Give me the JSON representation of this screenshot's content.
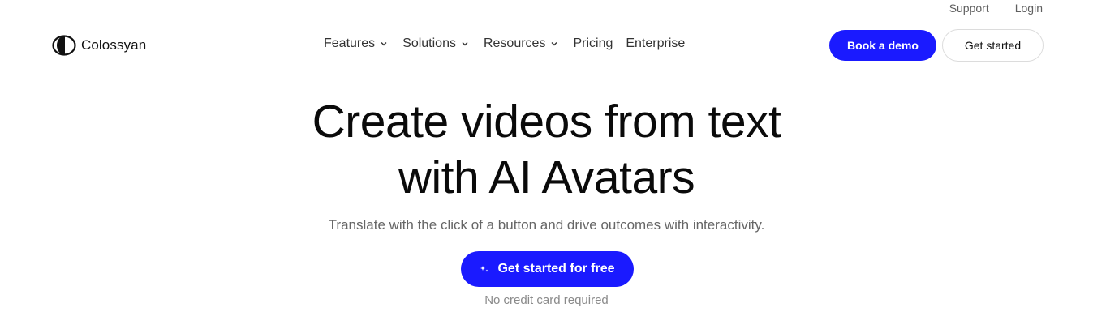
{
  "top_links": {
    "support": "Support",
    "login": "Login"
  },
  "brand": {
    "name": "Colossyan"
  },
  "nav": {
    "items": [
      {
        "label": "Features",
        "has_dropdown": true
      },
      {
        "label": "Solutions",
        "has_dropdown": true
      },
      {
        "label": "Resources",
        "has_dropdown": true
      },
      {
        "label": "Pricing",
        "has_dropdown": false
      },
      {
        "label": "Enterprise",
        "has_dropdown": false
      }
    ],
    "book_demo_label": "Book a demo",
    "get_started_label": "Get started"
  },
  "hero": {
    "title_line1": "Create videos from text",
    "title_line2": "with AI Avatars",
    "subtitle": "Translate with the click of a button and drive outcomes with interactivity.",
    "cta_label": "Get started for free",
    "cta_icon": "sparkle-icon",
    "note": "No credit card required"
  },
  "colors": {
    "accent": "#1a1aff",
    "text": "#0a0a0a",
    "muted": "#666666"
  }
}
